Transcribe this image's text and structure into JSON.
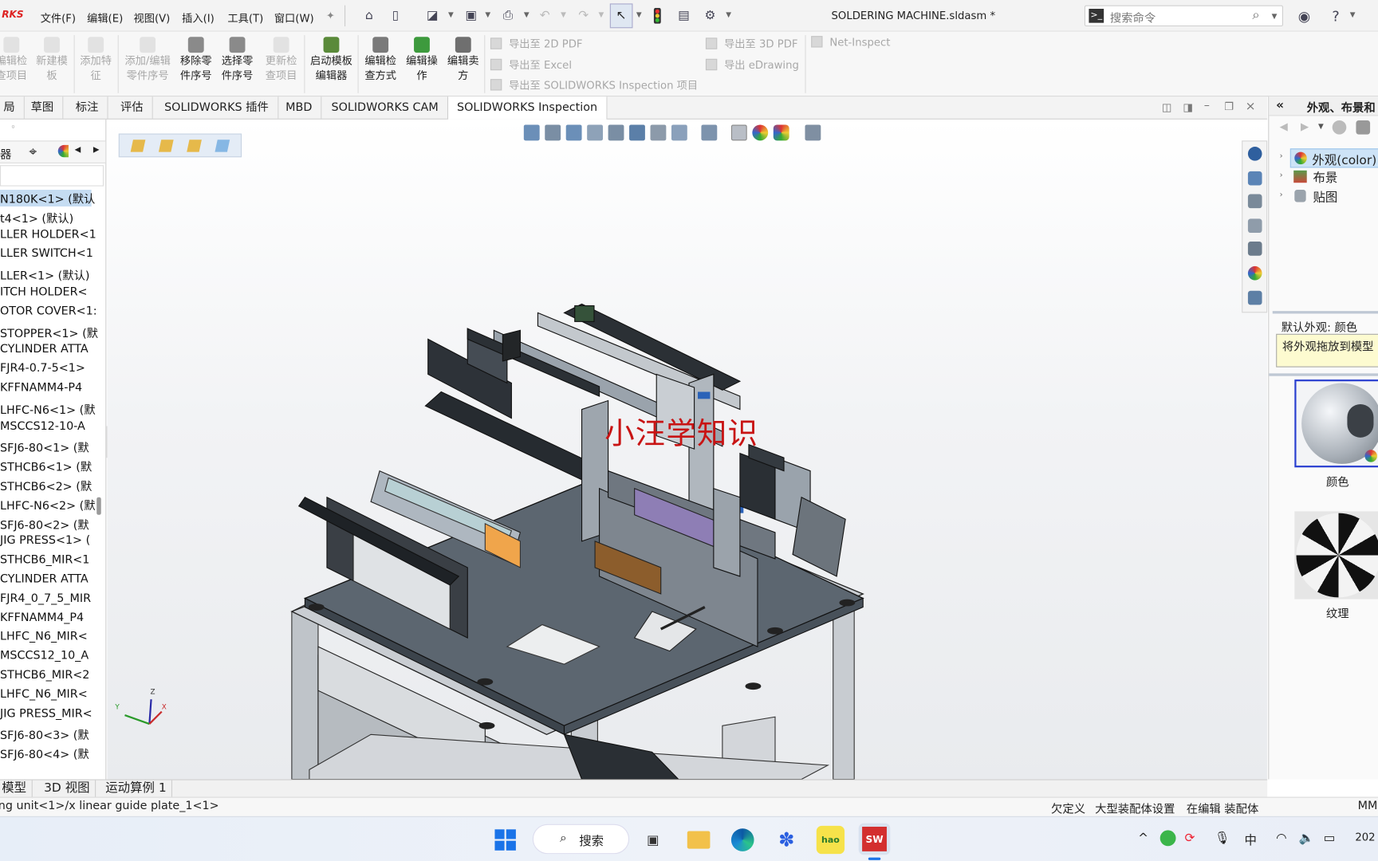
{
  "app": {
    "brand_fragment": "RKS",
    "document_title": "SOLDERING MACHINE.sldasm *"
  },
  "menu": [
    "文件(F)",
    "编辑(E)",
    "视图(V)",
    "插入(I)",
    "工具(T)",
    "窗口(W)"
  ],
  "search": {
    "placeholder": "搜索命令"
  },
  "ribbon": {
    "group1": [
      {
        "label": "编辑检查项目",
        "disabled": true
      },
      {
        "label": "新建模板",
        "disabled": true
      },
      {
        "label": "添加特征",
        "disabled": true
      },
      {
        "label": "添加/编辑零件序号",
        "disabled": true
      },
      {
        "label": "移除零件序号",
        "disabled": false
      },
      {
        "label": "选择零件序号",
        "disabled": false
      },
      {
        "label": "更新检查项目",
        "disabled": true
      },
      {
        "label": "启动模板编辑器",
        "disabled": false
      },
      {
        "label": "编辑检查方式",
        "disabled": false
      },
      {
        "label": "编辑操作",
        "disabled": false
      },
      {
        "label": "编辑卖方",
        "disabled": false
      }
    ],
    "export_col1": [
      "导出至 2D PDF",
      "导出至 Excel",
      "导出至 SOLIDWORKS Inspection 项目"
    ],
    "export_col2": [
      "导出至 3D PDF",
      "导出 eDrawing"
    ],
    "net_inspect": "Net-Inspect"
  },
  "tabs": [
    "局",
    "草图",
    "标注",
    "评估",
    "SOLIDWORKS 插件",
    "MBD",
    "SOLIDWORKS CAM",
    "SOLIDWORKS Inspection"
  ],
  "active_tab": "SOLIDWORKS Inspection",
  "feature_tree": [
    "N180K<1> (默认",
    "t4<1> (默认)",
    "LLER HOLDER<1",
    "LLER SWITCH<1",
    "LLER<1> (默认)",
    "ITCH HOLDER<",
    "OTOR COVER<1:",
    "STOPPER<1> (默",
    "CYLINDER ATTA",
    "FJR4-0.7-5<1>",
    "KFFNAMM4-P4",
    "LHFC-N6<1> (默",
    "MSCCS12-10-A",
    "SFJ6-80<1> (默",
    "STHCB6<1> (默",
    "STHCB6<2> (默",
    "LHFC-N6<2> (默",
    "SFJ6-80<2> (默",
    "JIG PRESS<1> (",
    "STHCB6_MIR<1",
    "CYLINDER ATTA",
    "FJR4_0_7_5_MIR",
    "KFFNAMM4_P4",
    "LHFC_N6_MIR<",
    "MSCCS12_10_A",
    "STHCB6_MIR<2",
    "LHFC_N6_MIR<",
    "JIG PRESS_MIR<",
    "SFJ6-80<3> (默",
    "SFJ6-80<4> (默"
  ],
  "viewport": {
    "watermark": "小汪学知识",
    "triad": {
      "x": "X",
      "y": "Y",
      "z": "Z"
    }
  },
  "taskpane": {
    "title": "外观、布景和",
    "tree": [
      "外观(color)",
      "布景",
      "贴图"
    ],
    "default_appearance": "默认外观: 颜色",
    "tooltip": "将外观拖放到模型",
    "swatches": [
      "颜色",
      "纹理"
    ]
  },
  "bottom_tabs": [
    "模型",
    "3D 视图",
    "运动算例 1"
  ],
  "status": {
    "path": "ng unit<1>/x linear guide plate_1<1>",
    "underdefined": "欠定义",
    "large_assembly": "大型装配体设置",
    "editing": "在编辑 装配体",
    "units": "MM"
  },
  "taskbar": {
    "search_label": "搜索",
    "ime": "中",
    "clock": "202"
  },
  "colors": {
    "accent": "#1e6fd9",
    "watermark": "#c81414",
    "tree_selection": "#c5dcf2",
    "solidworks_red": "#d32f2f"
  }
}
